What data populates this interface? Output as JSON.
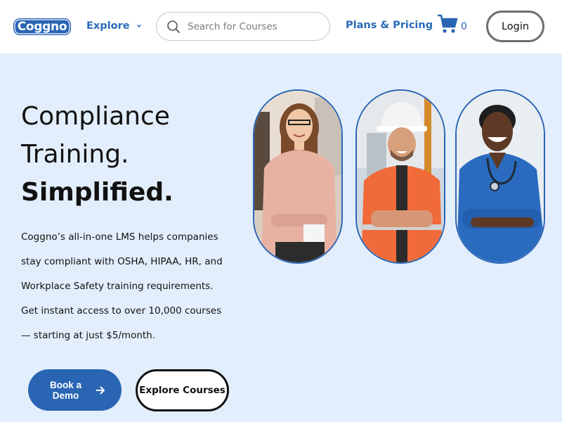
{
  "header": {
    "logo_text": "Coggno",
    "explore_label": "Explore",
    "search_placeholder": "Search for Courses",
    "plans_label": "Plans & Pricing",
    "cart_count": "0",
    "login_label": "Login"
  },
  "hero": {
    "headline": [
      "Compliance",
      "Training.",
      "Simplified."
    ],
    "description_lines": [
      "Coggno’s all-in-one LMS helps companies",
      "stay compliant with OSHA, HIPAA, HR, and",
      "Workplace Safety training requirements.",
      "Get instant access to over 10,000 courses",
      "— starting at just $5/month."
    ],
    "book_demo_label": "Book a Demo",
    "explore_courses_label": "Explore Courses"
  },
  "colors": {
    "brand_blue": "#2a65b4",
    "nav_blue": "#2a6bb8",
    "hero_background": "#e3eefc"
  },
  "icons": [
    "chevron-down-icon",
    "search-icon",
    "cart-icon",
    "arrow-right-icon",
    "star-icon"
  ]
}
